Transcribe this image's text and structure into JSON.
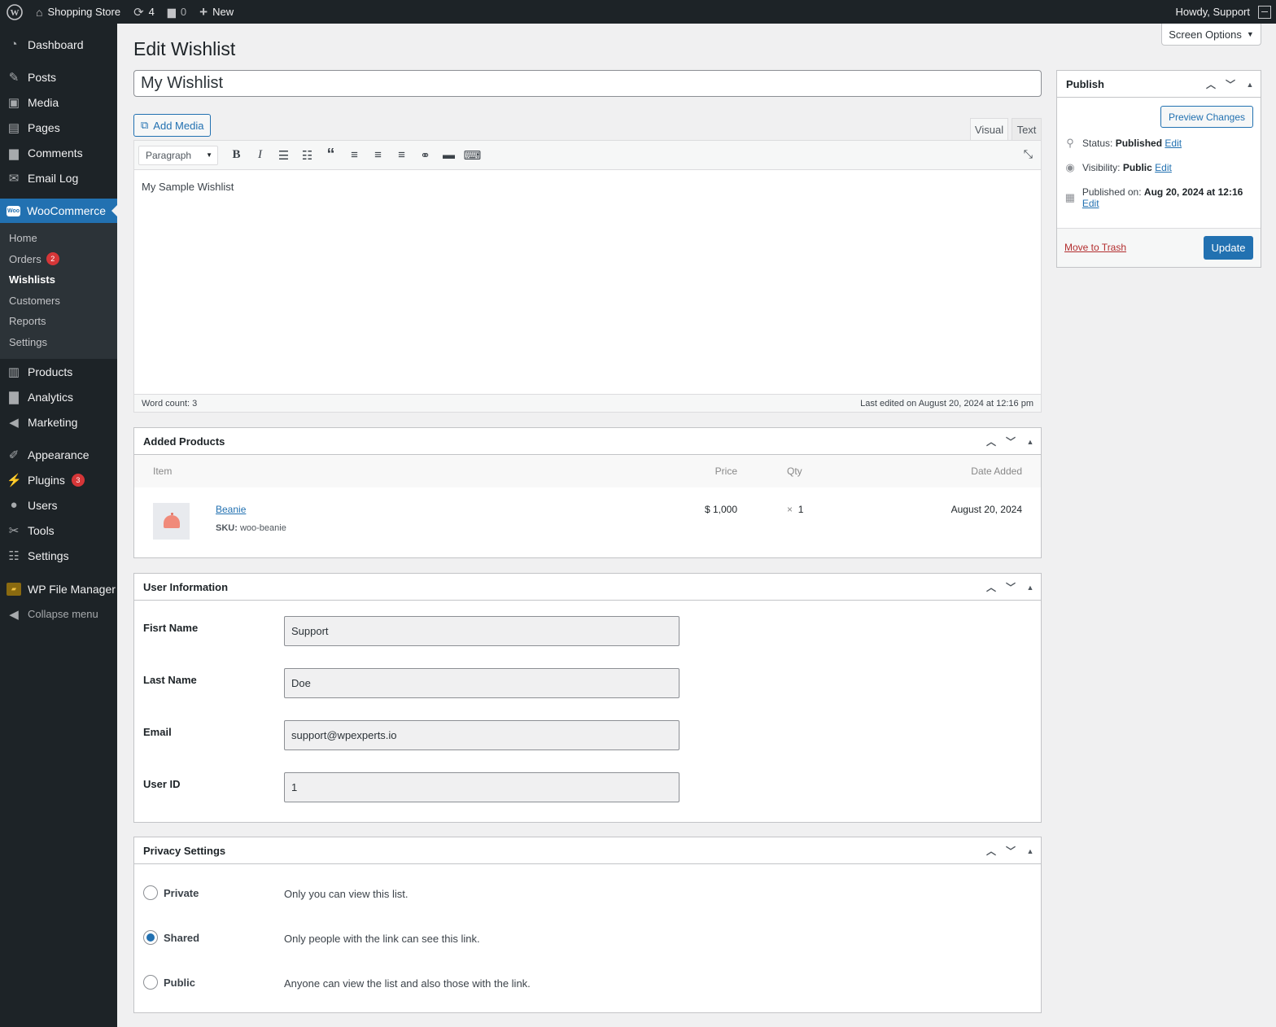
{
  "adminbar": {
    "wp_logo": "wordpress-icon",
    "site_name": "Shopping Store",
    "updates_count": "4",
    "comments_count": "0",
    "new_label": "New",
    "howdy": "Howdy, Support"
  },
  "sidebar": {
    "items": [
      {
        "label": "Dashboard",
        "icon": "dashboard-icon"
      },
      {
        "label": "Posts",
        "icon": "pin-icon"
      },
      {
        "label": "Media",
        "icon": "media-icon"
      },
      {
        "label": "Pages",
        "icon": "pages-icon"
      },
      {
        "label": "Comments",
        "icon": "comment-icon"
      },
      {
        "label": "Email Log",
        "icon": "email-icon"
      },
      {
        "label": "WooCommerce",
        "icon": "woo-icon"
      },
      {
        "label": "Products",
        "icon": "archive-icon"
      },
      {
        "label": "Analytics",
        "icon": "chart-icon"
      },
      {
        "label": "Marketing",
        "icon": "megaphone-icon"
      },
      {
        "label": "Appearance",
        "icon": "brush-icon"
      },
      {
        "label": "Plugins",
        "icon": "plug-icon"
      },
      {
        "label": "Users",
        "icon": "user-icon"
      },
      {
        "label": "Tools",
        "icon": "wrench-icon"
      },
      {
        "label": "Settings",
        "icon": "settings-icon"
      },
      {
        "label": "WP File Manager",
        "icon": "folder-icon"
      },
      {
        "label": "Collapse menu",
        "icon": "collapse-icon"
      }
    ],
    "woo_logo_text": "Woo",
    "plugins_badge": "3",
    "submenu": [
      {
        "label": "Home"
      },
      {
        "label": "Orders",
        "badge": "2"
      },
      {
        "label": "Wishlists"
      },
      {
        "label": "Customers"
      },
      {
        "label": "Reports"
      },
      {
        "label": "Settings"
      }
    ]
  },
  "main": {
    "screen_options": "Screen Options",
    "page_title": "Edit Wishlist",
    "post_title": "My Wishlist",
    "add_media": "Add Media",
    "tab_visual": "Visual",
    "tab_text": "Text",
    "format_select": "Paragraph",
    "editor_content": "My Sample Wishlist",
    "word_count": "Word count: 3",
    "last_edited": "Last edited on August 20, 2024 at 12:16 pm"
  },
  "added_products": {
    "title": "Added Products",
    "columns": {
      "item": "Item",
      "price": "Price",
      "qty": "Qty",
      "date": "Date Added"
    },
    "rows": [
      {
        "name": "Beanie",
        "sku_label": "SKU:",
        "sku": "woo-beanie",
        "price": "$ 1,000",
        "qty_prefix": "×",
        "qty": "1",
        "date": "August 20, 2024"
      }
    ]
  },
  "user_info": {
    "title": "User Information",
    "first_name_label": "Fisrt Name",
    "first_name": "Support",
    "last_name_label": "Last Name",
    "last_name": "Doe",
    "email_label": "Email",
    "email": "support@wpexperts.io",
    "user_id_label": "User ID",
    "user_id": "1"
  },
  "privacy": {
    "title": "Privacy Settings",
    "options": [
      {
        "label": "Private",
        "desc": "Only you can view this list.",
        "checked": false
      },
      {
        "label": "Shared",
        "desc": "Only people with the link can see this link.",
        "checked": true
      },
      {
        "label": "Public",
        "desc": "Anyone can view the list and also those with the link.",
        "checked": false
      }
    ]
  },
  "publish": {
    "title": "Publish",
    "preview": "Preview Changes",
    "status_label": "Status:",
    "status_value": "Published",
    "visibility_label": "Visibility:",
    "visibility_value": "Public",
    "published_label": "Published on:",
    "published_value": "Aug 20, 2024 at 12:16",
    "edit": "Edit",
    "trash": "Move to Trash",
    "update": "Update"
  },
  "colors": {
    "accent": "#2271b1",
    "sidebar_bg": "#1d2327",
    "badge": "#d63638"
  }
}
